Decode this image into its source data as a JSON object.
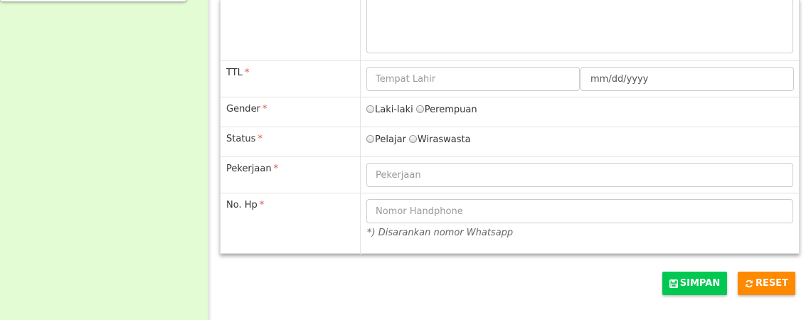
{
  "form": {
    "rows": {
      "ttl": {
        "label": "TTL",
        "required": "*",
        "place_placeholder": "Tempat Lahir",
        "date_placeholder": "mm/dd/yyyy"
      },
      "gender": {
        "label": "Gender",
        "required": "*",
        "options": [
          "Laki-laki",
          "Perempuan"
        ]
      },
      "status": {
        "label": "Status",
        "required": "*",
        "options": [
          "Pelajar",
          "Wiraswasta"
        ]
      },
      "pekerjaan": {
        "label": "Pekerjaan",
        "required": "*",
        "placeholder": "Pekerjaan"
      },
      "nohp": {
        "label": "No. Hp",
        "required": "*",
        "placeholder": "Nomor Handphone",
        "hint": "*) Disarankan nomor Whatsapp"
      }
    }
  },
  "actions": {
    "save_label": "SIMPAN",
    "reset_label": "RESET"
  },
  "colors": {
    "sidebar_bg": "#e3fcd4",
    "save_button": "#00c851",
    "reset_button": "#ff8a00",
    "required_mark": "#d9534f"
  },
  "icons": {
    "save": "floppy-disk-icon",
    "reset": "refresh-icon"
  }
}
